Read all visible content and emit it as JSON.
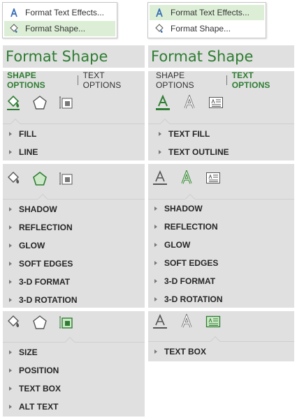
{
  "menus": [
    {
      "items": [
        {
          "label": "Format Text Effects...",
          "icon": "text-effects-icon",
          "highlighted": false
        },
        {
          "label": "Format Shape...",
          "icon": "format-shape-icon",
          "highlighted": true
        }
      ]
    },
    {
      "items": [
        {
          "label": "Format Text Effects...",
          "icon": "text-effects-icon",
          "highlighted": true
        },
        {
          "label": "Format Shape...",
          "icon": "format-shape-icon",
          "highlighted": false
        }
      ]
    }
  ],
  "pane_title": "Format Shape",
  "tabs": {
    "shape": "SHAPE OPTIONS",
    "text": "TEXT OPTIONS"
  },
  "shape_panels": [
    {
      "sections": [
        "FILL",
        "LINE"
      ],
      "active": "fill-line"
    },
    {
      "sections": [
        "SHADOW",
        "REFLECTION",
        "GLOW",
        "SOFT EDGES",
        "3-D FORMAT",
        "3-D ROTATION"
      ],
      "active": "effects"
    },
    {
      "sections": [
        "SIZE",
        "POSITION",
        "TEXT BOX",
        "ALT TEXT"
      ],
      "active": "size-properties"
    }
  ],
  "text_panels": [
    {
      "sections": [
        "TEXT FILL",
        "TEXT OUTLINE"
      ],
      "active": "text-fill-outline"
    },
    {
      "sections": [
        "SHADOW",
        "REFLECTION",
        "GLOW",
        "SOFT EDGES",
        "3-D FORMAT",
        "3-D ROTATION"
      ],
      "active": "text-effects"
    },
    {
      "sections": [
        "TEXT BOX"
      ],
      "active": "textbox"
    }
  ],
  "colors": {
    "accent": "#2e7d32",
    "pane_bg": "#e0e0e0",
    "highlight": "#dcefd6"
  }
}
